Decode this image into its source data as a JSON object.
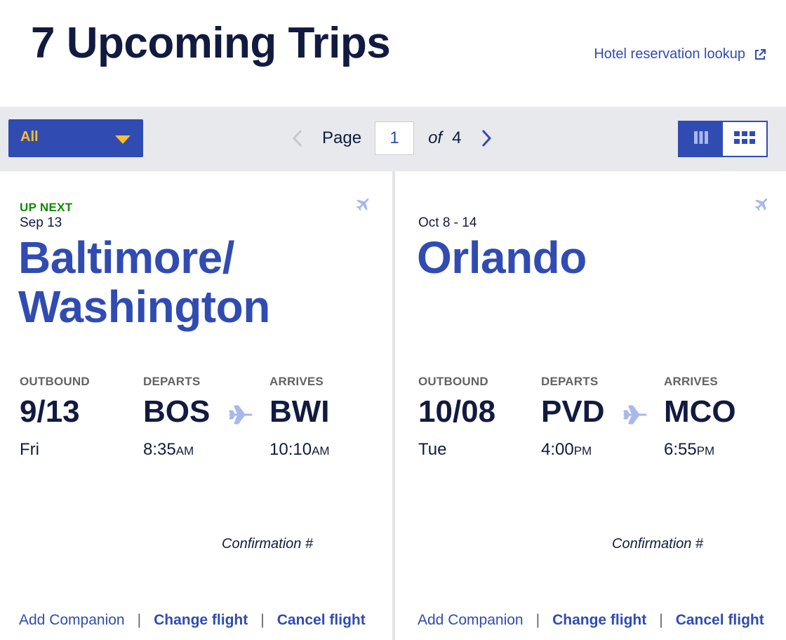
{
  "header": {
    "title": "7 Upcoming Trips",
    "hotel_link": "Hotel reservation lookup"
  },
  "toolbar": {
    "filter_value": "All",
    "page_label": "Page",
    "current_page": "1",
    "of_label": "of",
    "total_pages": "4"
  },
  "colors": {
    "brand_blue": "#304cb2",
    "navy_text": "#111b40",
    "filter_text": "#ffbf27",
    "up_next_green": "#108a00",
    "light_plane": "#a7b8ec"
  },
  "icons": [
    "external-link-icon",
    "chevron-down-icon",
    "chevron-left-icon",
    "chevron-right-icon",
    "list-view-icon",
    "grid-view-icon",
    "plane-icon"
  ],
  "trips": [
    {
      "badge": "UP NEXT",
      "date_range": "Sep 13",
      "destination_line1": "Baltimore/",
      "destination_line2": "Washington",
      "direction_label": "OUTBOUND",
      "departs_label": "DEPARTS",
      "arrives_label": "ARRIVES",
      "date": "9/13",
      "day": "Fri",
      "from": "BOS",
      "depart_time": "8:35",
      "depart_ampm": "AM",
      "to": "BWI",
      "arrive_time": "10:10",
      "arrive_ampm": "AM",
      "confirmation_label": "Confirmation #",
      "actions": {
        "add_companion": "Add Companion",
        "change": "Change flight",
        "cancel": "Cancel flight",
        "separator": "|"
      }
    },
    {
      "badge": "",
      "date_range": "Oct 8 - 14",
      "destination_line1": "Orlando",
      "destination_line2": "",
      "direction_label": "OUTBOUND",
      "departs_label": "DEPARTS",
      "arrives_label": "ARRIVES",
      "date": "10/08",
      "day": "Tue",
      "from": "PVD",
      "depart_time": "4:00",
      "depart_ampm": "PM",
      "to": "MCO",
      "arrive_time": "6:55",
      "arrive_ampm": "PM",
      "confirmation_label": "Confirmation #",
      "actions": {
        "add_companion": "Add Companion",
        "change": "Change flight",
        "cancel": "Cancel flight",
        "separator": "|"
      }
    }
  ]
}
